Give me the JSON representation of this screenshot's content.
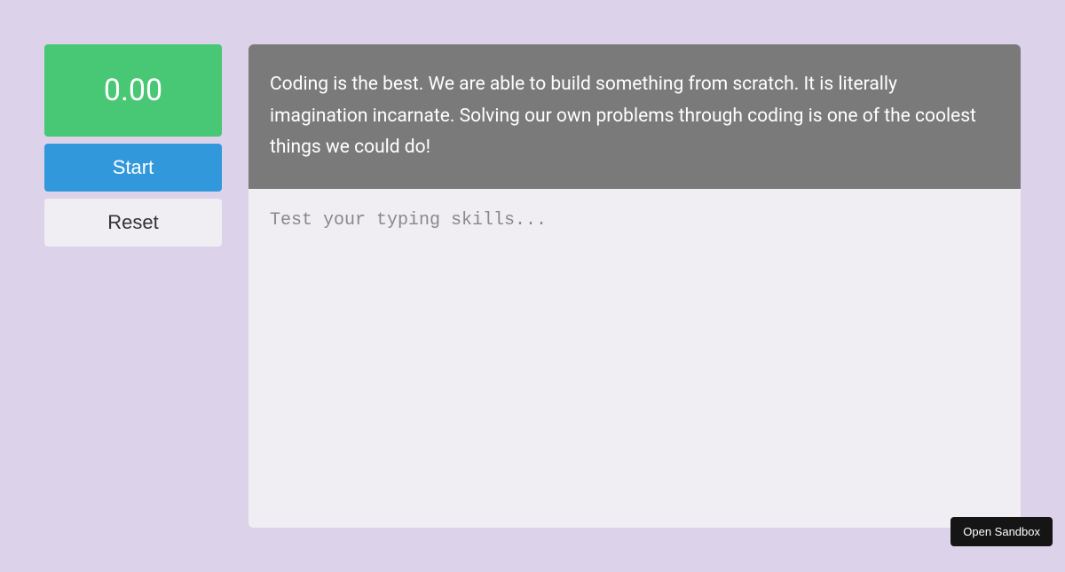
{
  "timer": {
    "value": "0.00"
  },
  "controls": {
    "start_label": "Start",
    "reset_label": "Reset"
  },
  "prompt": {
    "text": "Coding is the best. We are able to build something from scratch. It is literally imagination incarnate. Solving our own problems through coding is one of the coolest things we could do!"
  },
  "input": {
    "placeholder": "Test your typing skills..."
  },
  "sandbox": {
    "label": "Open Sandbox"
  }
}
